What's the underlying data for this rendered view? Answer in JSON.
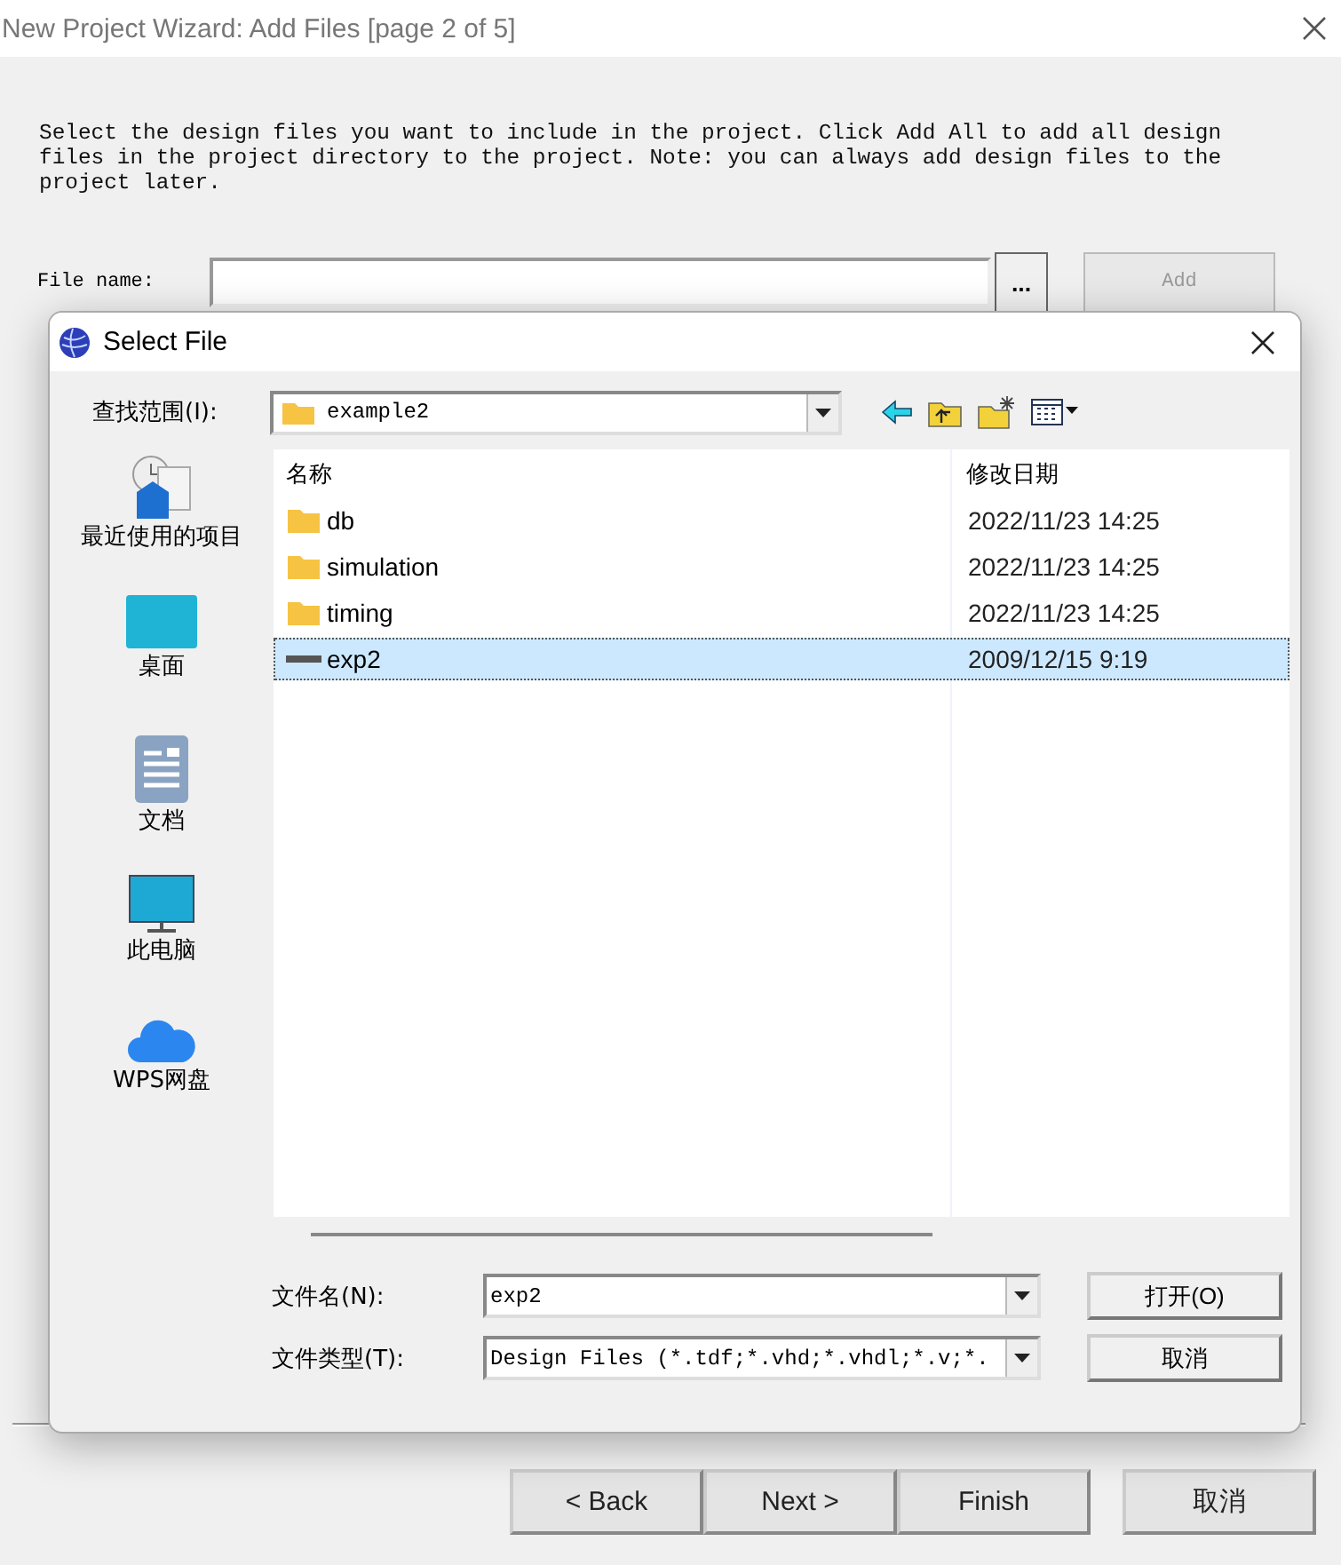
{
  "window": {
    "title": "New Project Wizard: Add Files [page 2 of 5]"
  },
  "description": "Select the design files you want to include in the project. Click Add All to add all design files in the project directory to the project. Note: you can always add design files to the project later.",
  "file_name": {
    "label": "File name:",
    "browse": "...",
    "add": {
      "label": "Add",
      "disabled": true
    }
  },
  "buttons": [
    {
      "label": "< Back",
      "disabled": false
    },
    {
      "label": "Next >",
      "disabled": false
    },
    {
      "label": "Finish",
      "disabled": false
    },
    {
      "label": "取消",
      "disabled": false
    }
  ],
  "dialog": {
    "title": "Select File",
    "look_in": {
      "label": "查找范围(I):",
      "value": "example2"
    },
    "places": [
      {
        "label": "最近使用的项目",
        "kind": "recent"
      },
      {
        "label": "桌面",
        "kind": "desktop"
      },
      {
        "label": "文档",
        "kind": "documents"
      },
      {
        "label": "此电脑",
        "kind": "computer"
      },
      {
        "label": "WPS网盘",
        "kind": "cloud"
      }
    ],
    "columns": [
      "名称",
      "修改日期"
    ],
    "files": [
      {
        "name": "db",
        "date": "2022/11/23 14:25",
        "kind": "folder",
        "selected": false
      },
      {
        "name": "simulation",
        "date": "2022/11/23 14:25",
        "kind": "folder",
        "selected": false
      },
      {
        "name": "timing",
        "date": "2022/11/23 14:25",
        "kind": "folder",
        "selected": false
      },
      {
        "name": "exp2",
        "date": "2009/12/15 9:19",
        "kind": "file",
        "selected": true
      }
    ],
    "file_name": {
      "label": "文件名(N):",
      "value": "exp2"
    },
    "file_type": {
      "label": "文件类型(T):",
      "value": "Design Files (*.tdf;*.vhd;*.vhdl;*.v;*."
    },
    "open_button": "打开(O)",
    "cancel_button": "取消"
  }
}
